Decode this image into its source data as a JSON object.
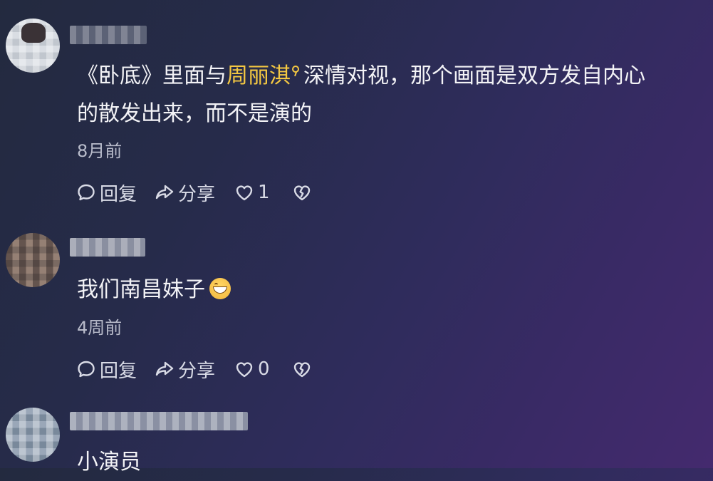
{
  "comments": [
    {
      "text_before": "《卧底》里面与",
      "mention": "周丽淇",
      "text_after": "深情对视，那个画面是双方发自内心",
      "text_line2": "的散发出来，而不是演的",
      "time": "8月前",
      "reply_label": "回复",
      "share_label": "分享",
      "like_count": "1"
    },
    {
      "text": "我们南昌妹子",
      "emoji": "grin-icon",
      "time": "4周前",
      "reply_label": "回复",
      "share_label": "分享",
      "like_count": "0"
    },
    {
      "text": "小演员"
    }
  ],
  "colors": {
    "mention": "#f4c842",
    "text": "#f3f3f6",
    "muted": "#b9bccb"
  }
}
